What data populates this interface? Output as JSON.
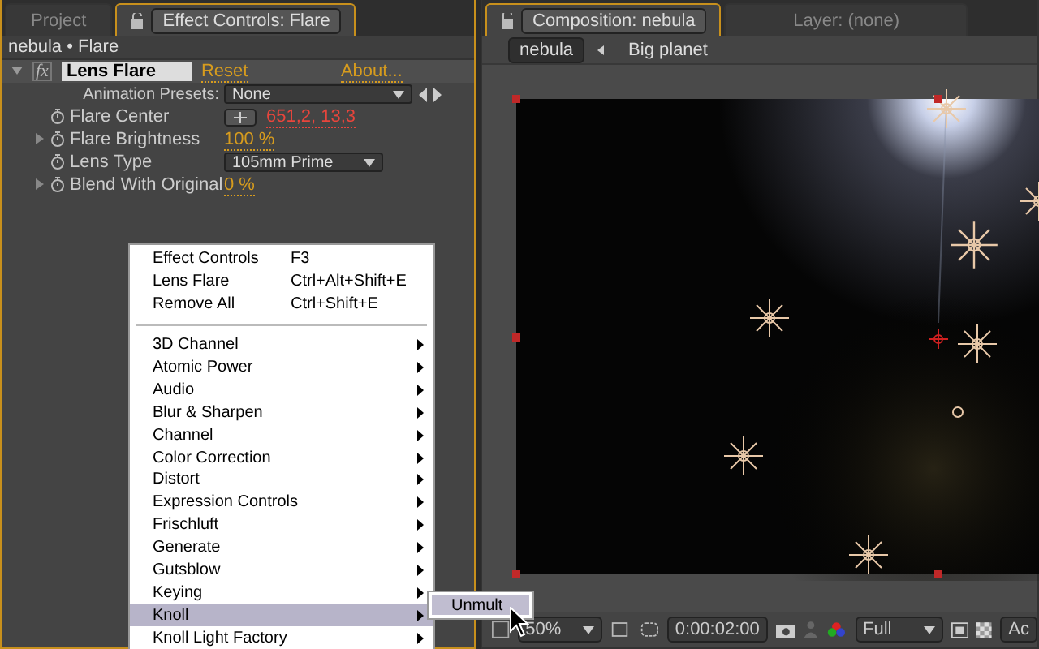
{
  "left_panel": {
    "tabs": [
      {
        "label": "Project",
        "selected": false
      },
      {
        "label": "Effect Controls: Flare",
        "selected": true
      }
    ],
    "breadcrumb": "nebula • Flare",
    "effect": {
      "icon_text": "fx",
      "name": "Lens Flare",
      "expanded": true,
      "reset": "Reset",
      "about": "About...",
      "presets_label": "Animation Presets:",
      "presets_value": "None",
      "properties": [
        {
          "kind": "point",
          "name": "Flare Center",
          "value": "651,2, 13,3",
          "expandable": false
        },
        {
          "kind": "number",
          "name": "Flare Brightness",
          "value": "100 %",
          "expandable": true
        },
        {
          "kind": "dropdown",
          "name": "Lens Type",
          "value": "105mm Prime",
          "expandable": false
        },
        {
          "kind": "number",
          "name": "Blend With Original",
          "value": "0 %",
          "expandable": true
        }
      ]
    }
  },
  "context_menu": {
    "items": [
      {
        "kind": "command",
        "label": "Effect Controls",
        "shortcut": "F3"
      },
      {
        "kind": "command",
        "label": "Lens Flare",
        "shortcut": "Ctrl+Alt+Shift+E"
      },
      {
        "kind": "command",
        "label": "Remove All",
        "shortcut": "Ctrl+Shift+E"
      },
      {
        "kind": "separator"
      },
      {
        "kind": "submenu",
        "label": "3D Channel",
        "selected": false
      },
      {
        "kind": "submenu",
        "label": "Atomic Power",
        "selected": false
      },
      {
        "kind": "submenu",
        "label": "Audio",
        "selected": false
      },
      {
        "kind": "submenu",
        "label": "Blur & Sharpen",
        "selected": false
      },
      {
        "kind": "submenu",
        "label": "Channel",
        "selected": false
      },
      {
        "kind": "submenu",
        "label": "Color Correction",
        "selected": false
      },
      {
        "kind": "submenu",
        "label": "Distort",
        "selected": false
      },
      {
        "kind": "submenu",
        "label": "Expression Controls",
        "selected": false
      },
      {
        "kind": "submenu",
        "label": "Frischluft",
        "selected": false
      },
      {
        "kind": "submenu",
        "label": "Generate",
        "selected": false
      },
      {
        "kind": "submenu",
        "label": "Gutsblow",
        "selected": false
      },
      {
        "kind": "submenu",
        "label": "Keying",
        "selected": false
      },
      {
        "kind": "submenu",
        "label": "Knoll",
        "selected": true
      },
      {
        "kind": "submenu",
        "label": "Knoll Light Factory",
        "selected": false
      }
    ],
    "submenu": {
      "items": [
        "Unmult"
      ]
    }
  },
  "right_panel": {
    "tabs": [
      {
        "label": "Composition: nebula",
        "selected": true
      },
      {
        "label": "Layer: (none)",
        "selected": false
      }
    ],
    "breadcrumbs": [
      {
        "label": "nebula",
        "selected": true
      },
      {
        "label": "Big planet",
        "selected": false
      }
    ],
    "toolbar": {
      "zoom": "50%",
      "timecode": "0:00:02:00",
      "resolution": "Full",
      "cut_text": "Ac"
    }
  }
}
